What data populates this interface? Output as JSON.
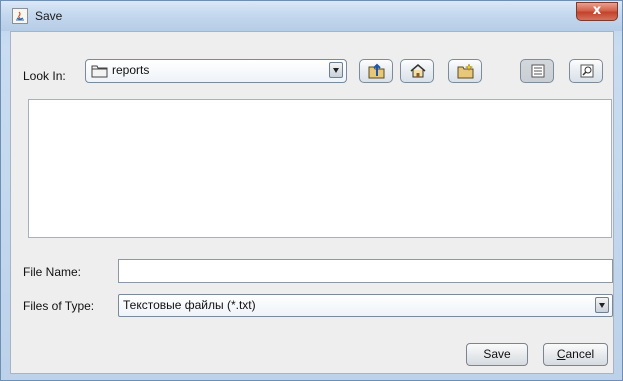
{
  "window": {
    "title": "Save",
    "close_glyph": "x"
  },
  "look_in": {
    "label": "Look In:",
    "value": "reports"
  },
  "toolbar": {
    "icons": [
      "up-one-level-icon",
      "home-icon",
      "new-folder-icon",
      "list-view-icon",
      "details-view-icon"
    ]
  },
  "file_list": {
    "items": []
  },
  "file_name": {
    "label": "File Name:",
    "value": ""
  },
  "file_type": {
    "label": "Files of Type:",
    "value": "Текстовые файлы (*.txt)"
  },
  "buttons": {
    "save": "Save",
    "cancel_mnemonic": "C",
    "cancel_rest": "ancel"
  },
  "colors": {
    "window_frame": "#bcd2ea",
    "client_bg": "#eeeeee",
    "close_button": "#c3432c"
  }
}
